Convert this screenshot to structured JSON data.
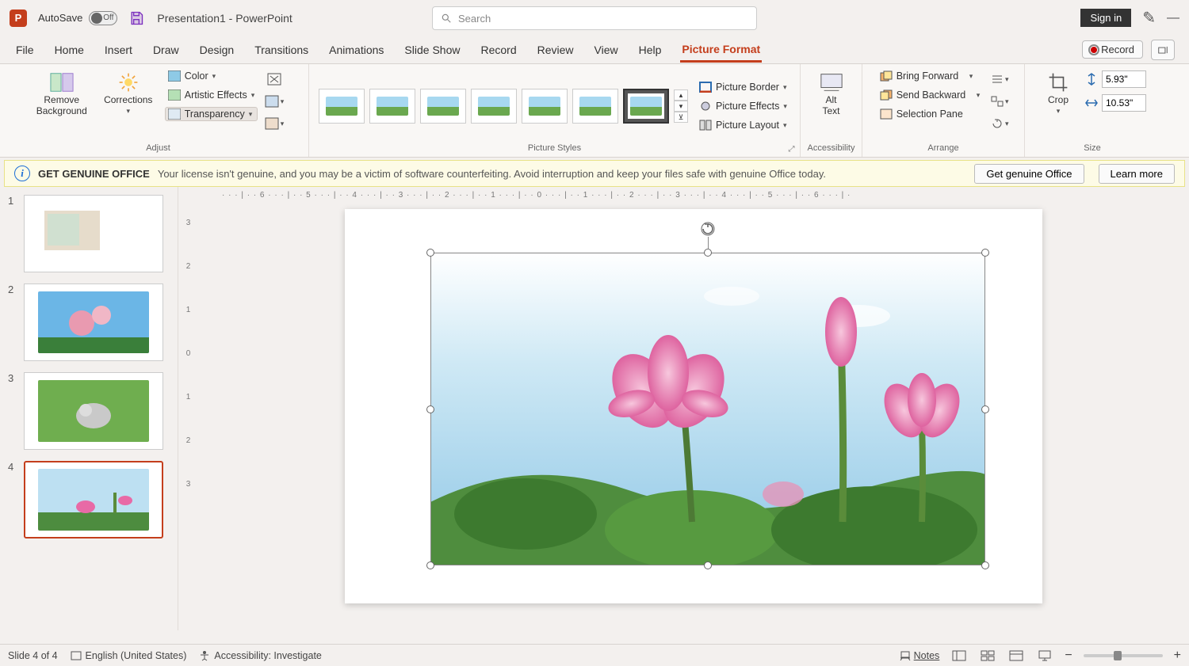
{
  "titlebar": {
    "autosave_label": "AutoSave",
    "autosave_state": "Off",
    "doc_title": "Presentation1 - PowerPoint",
    "search_placeholder": "Search",
    "signin": "Sign in"
  },
  "tabs": {
    "items": [
      "File",
      "Home",
      "Insert",
      "Draw",
      "Design",
      "Transitions",
      "Animations",
      "Slide Show",
      "Record",
      "Review",
      "View",
      "Help",
      "Picture Format"
    ],
    "active": "Picture Format",
    "record_btn": "Record"
  },
  "ribbon": {
    "adjust": {
      "remove_bg": "Remove\nBackground",
      "corrections": "Corrections",
      "color": "Color",
      "artistic": "Artistic Effects",
      "transparency": "Transparency",
      "group_label": "Adjust"
    },
    "styles": {
      "group_label": "Picture Styles",
      "border": "Picture Border",
      "effects": "Picture Effects",
      "layout": "Picture Layout"
    },
    "accessibility": {
      "alt_text": "Alt\nText",
      "group_label": "Accessibility"
    },
    "arrange": {
      "forward": "Bring Forward",
      "backward": "Send Backward",
      "pane": "Selection Pane",
      "group_label": "Arrange"
    },
    "size": {
      "crop": "Crop",
      "height": "5.93\"",
      "width": "10.53\"",
      "group_label": "Size"
    }
  },
  "warning": {
    "title": "GET GENUINE OFFICE",
    "msg": "Your license isn't genuine, and you may be a victim of software counterfeiting. Avoid interruption and keep your files safe with genuine Office today.",
    "btn1": "Get genuine Office",
    "btn2": "Learn more"
  },
  "thumbnails": {
    "items": [
      {
        "num": "1"
      },
      {
        "num": "2"
      },
      {
        "num": "3"
      },
      {
        "num": "4"
      }
    ],
    "selected": 4
  },
  "ruler": {
    "hmarks": "· · · | · · 6 · · · | · · 5 · · · | · · 4 · · · | · · 3 · · · | · · 2 · · · | · · 1 · · · | · · 0 · · · | · · 1 · · · | · · 2 · · · | · · 3 · · · | · · 4 · · · | · · 5 · · · | · · 6 · · · | ·",
    "vmarks": [
      "3",
      "2",
      "1",
      "0",
      "1",
      "2",
      "3"
    ]
  },
  "status": {
    "slide_info": "Slide 4 of 4",
    "language": "English (United States)",
    "accessibility": "Accessibility: Investigate",
    "notes": "Notes"
  }
}
